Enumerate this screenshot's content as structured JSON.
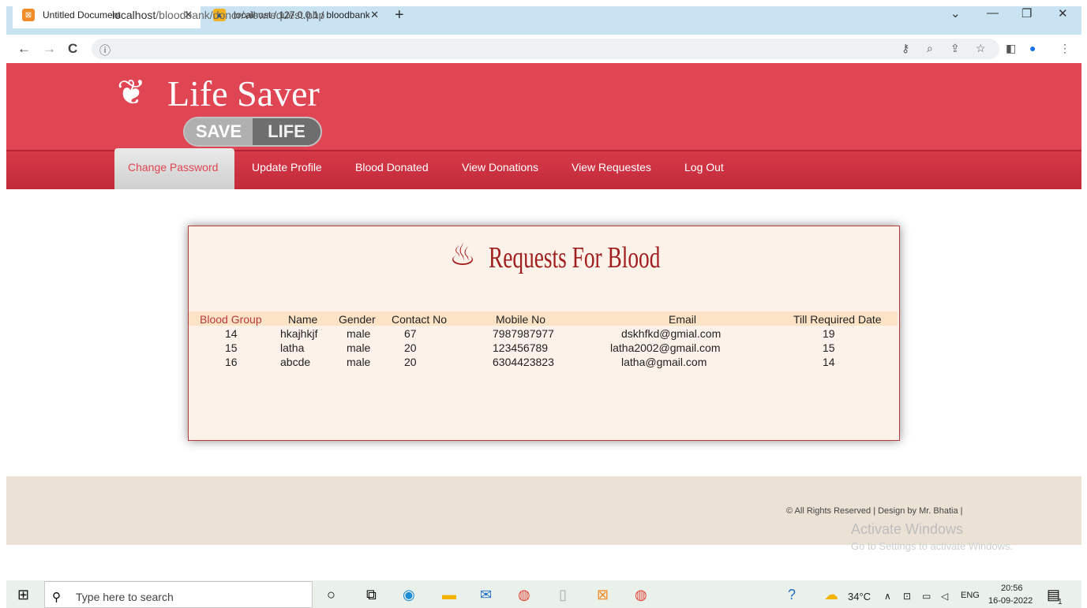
{
  "browser": {
    "tabs": [
      {
        "label": "Untitled Document",
        "active": true
      },
      {
        "label": "localhost / 127.0.0.1 / bloodbank",
        "active": false
      }
    ],
    "url_host": "localhost",
    "url_path": "/bloodbank/donor/viewrequest.php"
  },
  "site": {
    "logo_title": "Life Saver",
    "logo_badge_left": "SAVE",
    "logo_badge_right": "LIFE",
    "menu": [
      {
        "label": "Change Password",
        "active": true
      },
      {
        "label": "Update Profile"
      },
      {
        "label": "Blood Donated"
      },
      {
        "label": "View Donations"
      },
      {
        "label": "View Requestes"
      },
      {
        "label": "Log Out"
      }
    ]
  },
  "requests": {
    "title": "Requests For Blood",
    "columns": [
      "Blood Group",
      "Name",
      "Gender",
      "Contact No",
      "Mobile No",
      "Email",
      "Till Required Date"
    ],
    "rows": [
      [
        "14",
        "hkajhkjf",
        "male",
        "67",
        "7987987977",
        "dskhfkd@gmial.com",
        "19"
      ],
      [
        "15",
        "latha",
        "male",
        "20",
        "123456789",
        "latha2002@gmail.com",
        "15"
      ],
      [
        "16",
        "abcde",
        "male",
        "20",
        "6304423823",
        "latha@gmail.com",
        "14"
      ]
    ]
  },
  "footer": {
    "copyright": "© All Rights Reserved | Design by Mr. Bhatia |",
    "watermark_title": "Activate Windows",
    "watermark_sub": "Go to Settings to activate Windows."
  },
  "taskbar": {
    "search_placeholder": "Type here to search",
    "weather": "34°C",
    "language": "ENG",
    "time": "20:56",
    "date": "16-09-2022",
    "notification_count": "1"
  },
  "colors": {
    "header_red": "#e04553",
    "panel_bg": "#fdf2e9",
    "title_red": "#a01e1e",
    "footer_bg": "#ebe1d5"
  }
}
